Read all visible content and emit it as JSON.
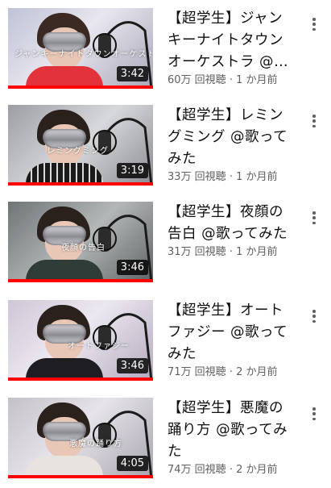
{
  "videos": [
    {
      "title": "【超学生】ジャンキーナイトタウンオーケストラ @歌ってみた",
      "views": "60万 回視聴",
      "age": "1 か月前",
      "duration": "3:42",
      "overlay": "ジャンキーナイトタウンオーケストラ",
      "watched": 1.0,
      "menu_icon": "more-vert-icon"
    },
    {
      "title": "【超学生】レミングミング @歌ってみた",
      "views": "33万 回視聴",
      "age": "1 か月前",
      "duration": "3:19",
      "overlay": "レミングミング",
      "watched": 1.0,
      "menu_icon": "more-vert-icon"
    },
    {
      "title": "【超学生】夜顔の告白 @歌ってみた",
      "views": "31万 回視聴",
      "age": "1 か月前",
      "duration": "3:46",
      "overlay": "夜顔の告白",
      "watched": 1.0,
      "menu_icon": "more-vert-icon"
    },
    {
      "title": "【超学生】オートファジー @歌ってみた",
      "views": "71万 回視聴",
      "age": "2 か月前",
      "duration": "3:46",
      "overlay": "オートファジー",
      "watched": 1.0,
      "menu_icon": "more-vert-icon"
    },
    {
      "title": "【超学生】悪魔の踊り方 @歌ってみた",
      "views": "74万 回視聴",
      "age": "2 か月前",
      "duration": "4:05",
      "overlay": "悪魔の踊り方",
      "watched": 1.0,
      "menu_icon": "more-vert-icon"
    }
  ],
  "meta_separator": " · ",
  "colors": {
    "progress": "#ff0000",
    "title_text": "#0f0f0f",
    "meta_text": "#606060"
  }
}
